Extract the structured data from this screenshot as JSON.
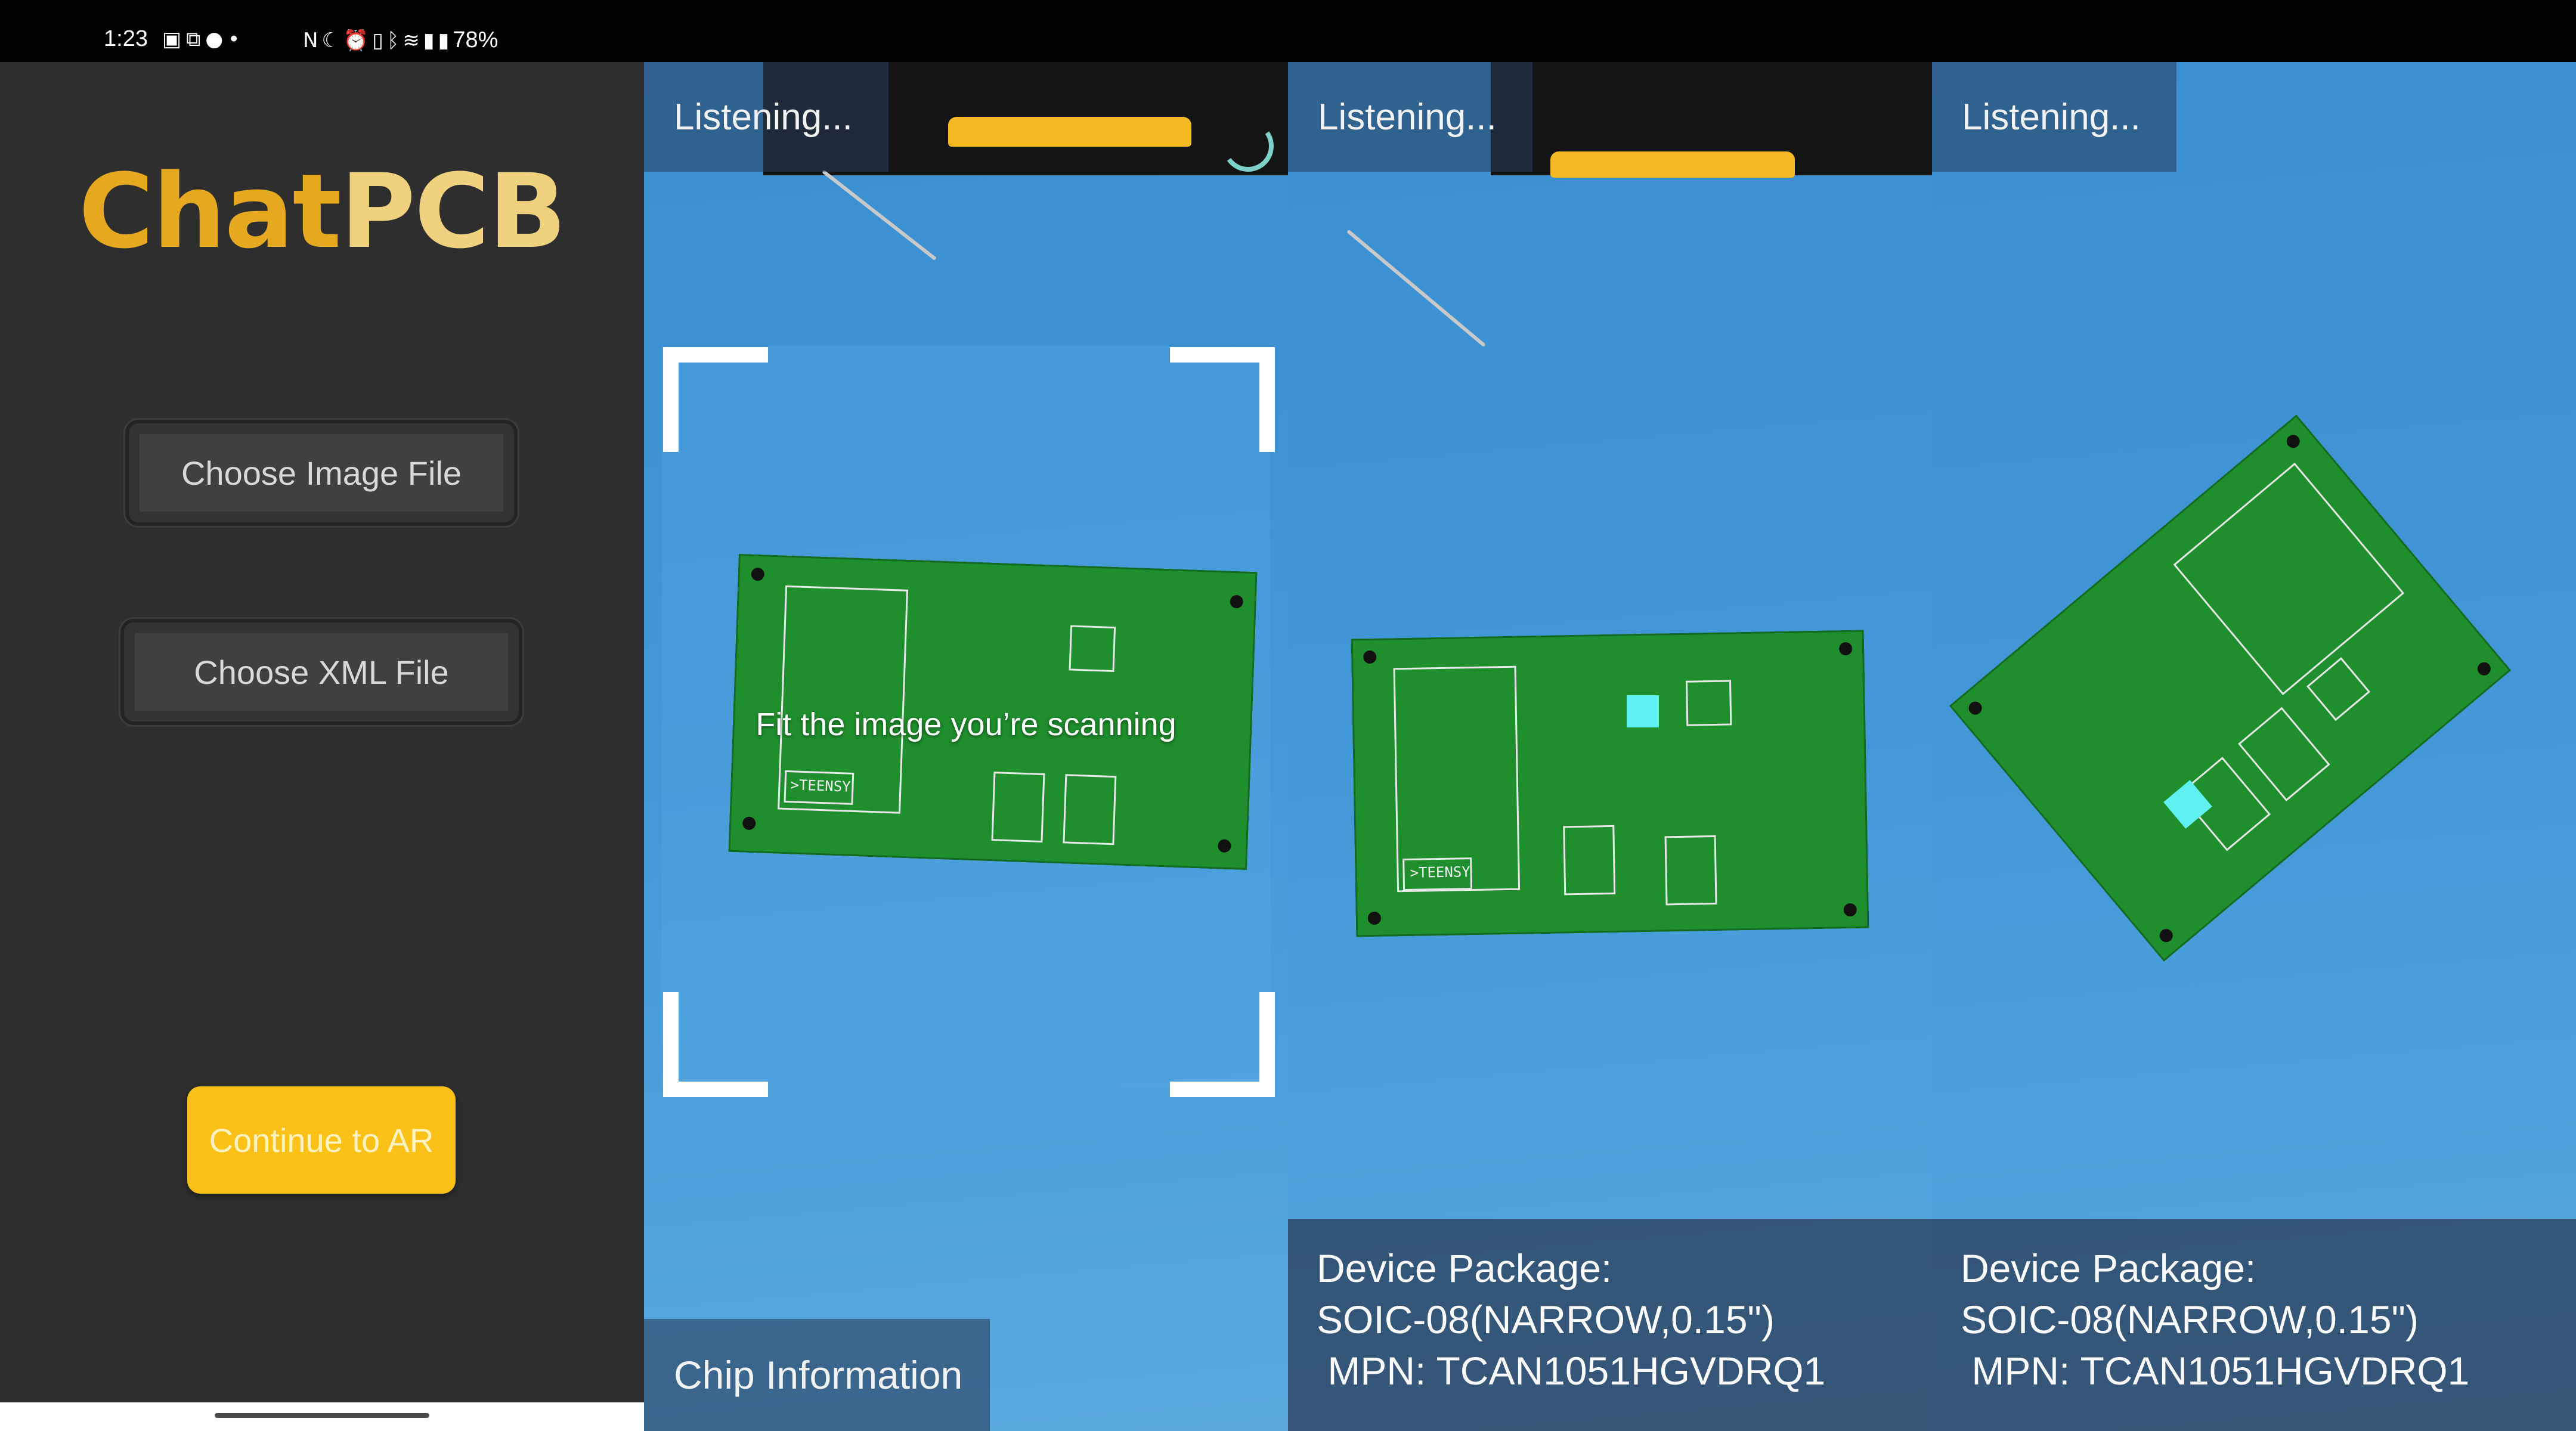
{
  "status_bar": {
    "time": "1:23",
    "battery": "78%",
    "left_icons": [
      "calendar-icon",
      "teams-icon",
      "chat-icon",
      "dot-icon"
    ],
    "right_icons": [
      "nfc-icon",
      "moon-icon",
      "alarm-icon",
      "vibrate-icon",
      "bluetooth-icon",
      "wifi-icon",
      "signal-icon",
      "battery-icon"
    ]
  },
  "app": {
    "logo_part1": "Chat",
    "logo_part2": "PCB",
    "choose_image_label": "Choose Image File",
    "choose_xml_label": "Choose XML File",
    "continue_label": "Continue to AR",
    "colors": {
      "accent": "#fcc117",
      "logo_gold": "#e6a81f",
      "logo_light": "#f0d27e",
      "background": "#2e2e2e"
    }
  },
  "scan_view": {
    "status": "Listening...",
    "hint": "Fit the image you’re scanning",
    "chip_info_label": "Chip Information"
  },
  "ar_view_1": {
    "status": "Listening...",
    "package_label": "Device Package:",
    "package_value": "SOIC-08(NARROW,0.15\")",
    "mpn": " MPN: TCAN1051HGVDRQ1"
  },
  "ar_view_2": {
    "status": "Listening...",
    "package_label": "Device Package:",
    "package_value": "SOIC-08(NARROW,0.15\")",
    "mpn": " MPN: TCAN1051HGVDRQ1"
  },
  "pcb": {
    "silk_label": ">TEENSY"
  }
}
